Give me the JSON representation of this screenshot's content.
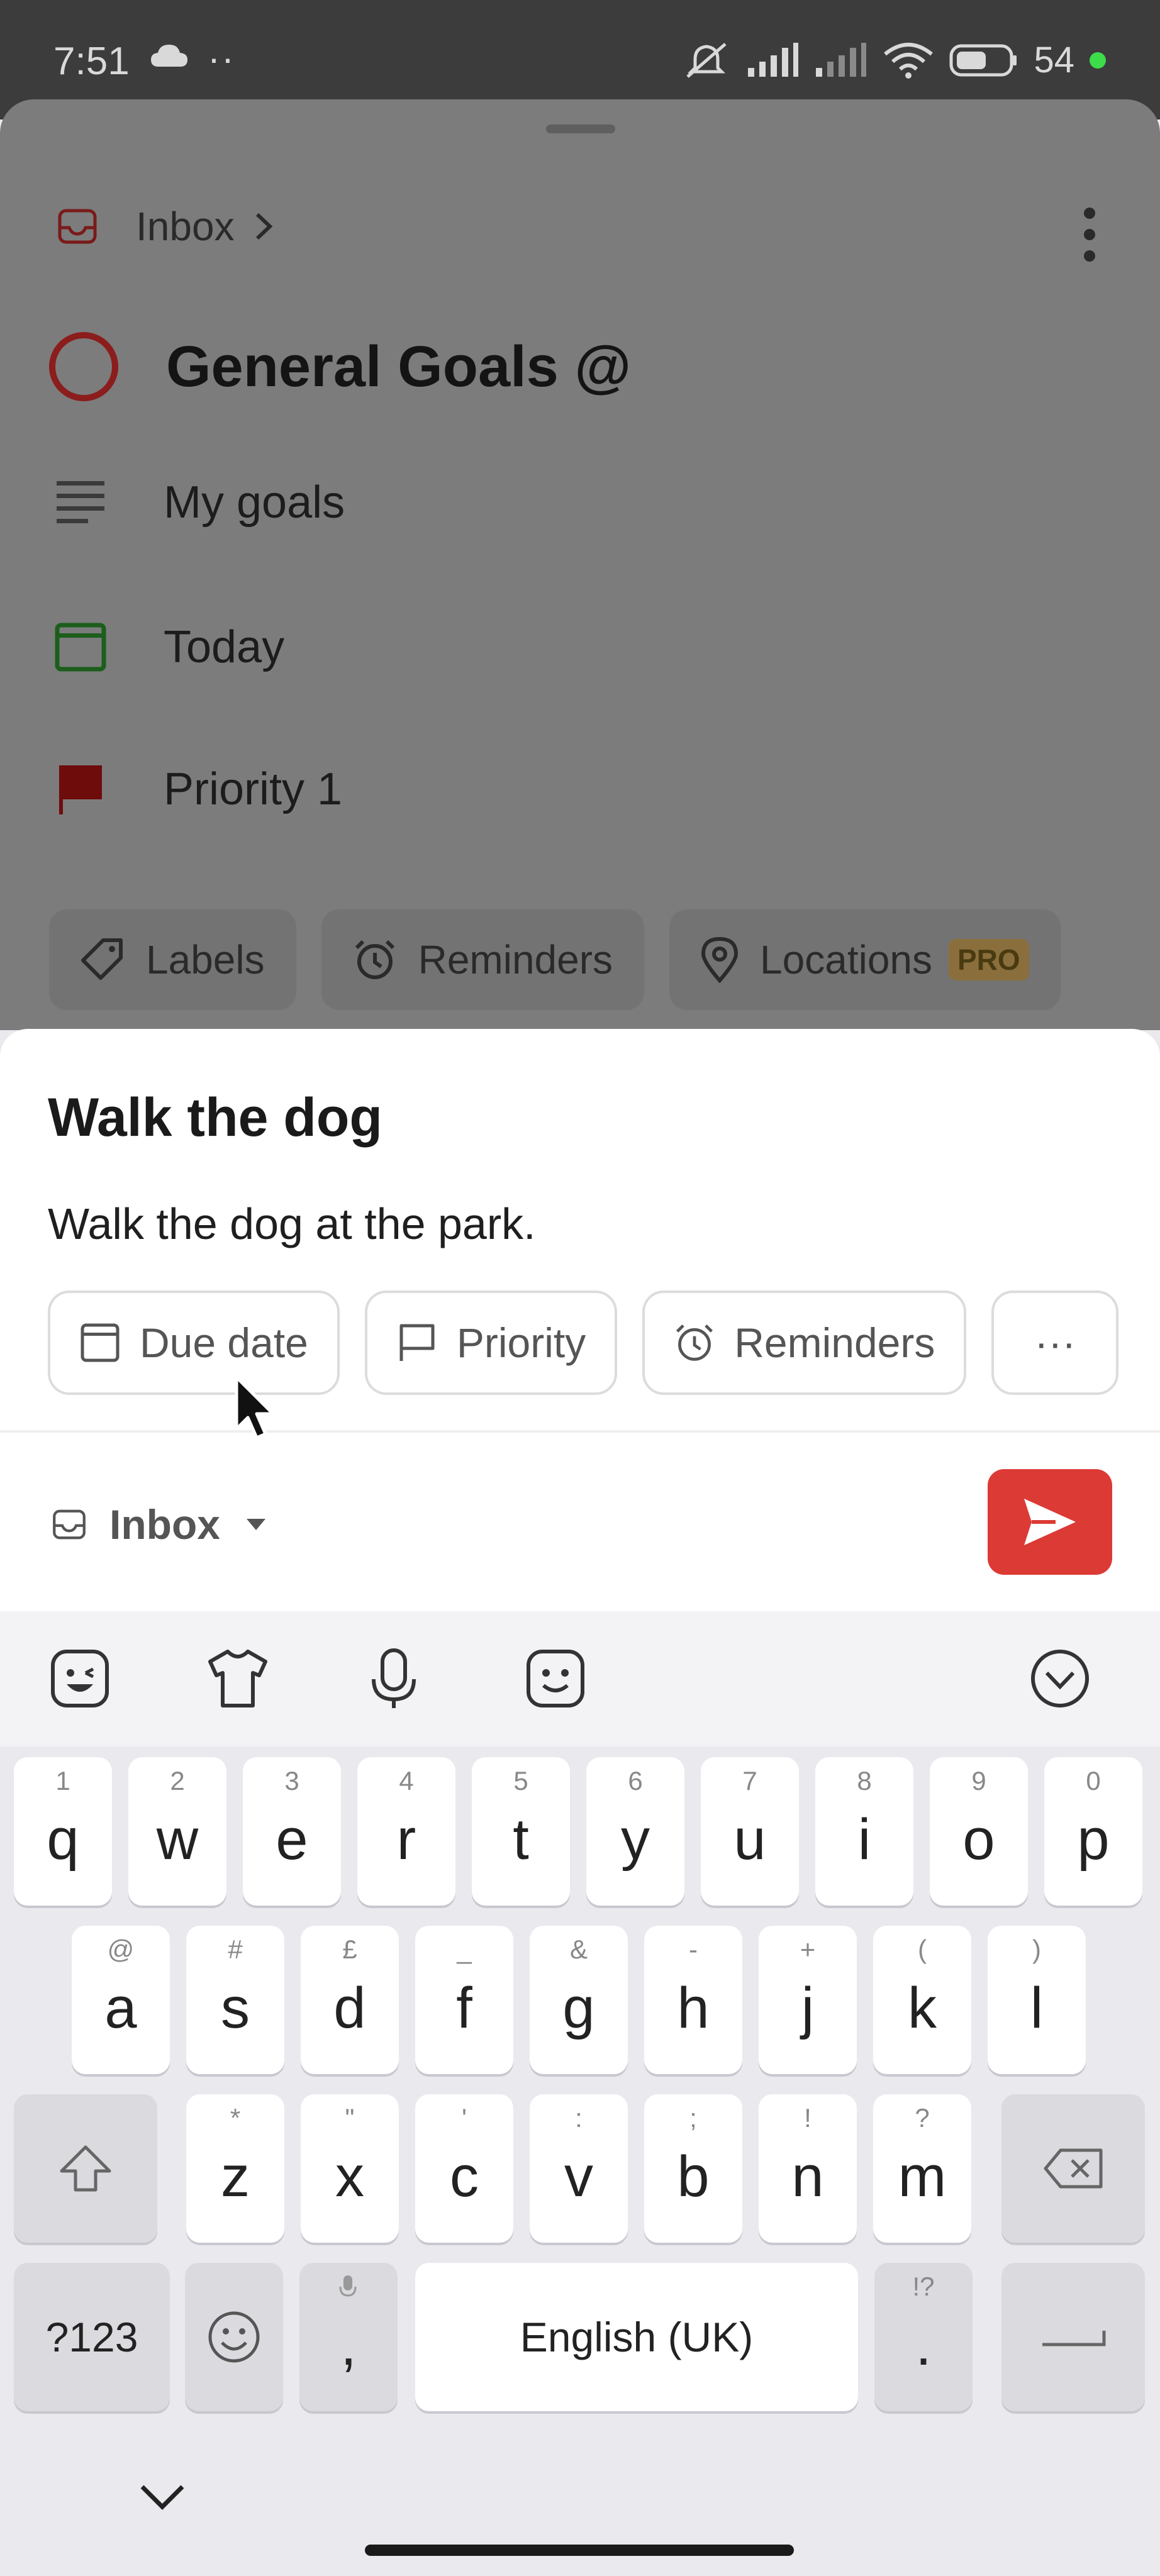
{
  "status_bar": {
    "time": "7:51",
    "extra": "··",
    "battery": "54"
  },
  "detail": {
    "breadcrumb": "Inbox",
    "task_title": "General Goals @",
    "description": "My goals",
    "due": "Today",
    "priority": "Priority 1",
    "chips": {
      "labels": "Labels",
      "reminders": "Reminders",
      "locations": "Locations",
      "pro_badge": "PRO"
    }
  },
  "quick_add": {
    "title": "Walk the dog",
    "description": "Walk the dog at the park.",
    "options": {
      "due_date": "Due date",
      "priority": "Priority",
      "reminders": "Reminders",
      "more": "···"
    },
    "project": "Inbox"
  },
  "keyboard": {
    "row1": [
      {
        "key": "q",
        "hint": "1"
      },
      {
        "key": "w",
        "hint": "2"
      },
      {
        "key": "e",
        "hint": "3"
      },
      {
        "key": "r",
        "hint": "4"
      },
      {
        "key": "t",
        "hint": "5"
      },
      {
        "key": "y",
        "hint": "6"
      },
      {
        "key": "u",
        "hint": "7"
      },
      {
        "key": "i",
        "hint": "8"
      },
      {
        "key": "o",
        "hint": "9"
      },
      {
        "key": "p",
        "hint": "0"
      }
    ],
    "row2": [
      {
        "key": "a",
        "hint": "@"
      },
      {
        "key": "s",
        "hint": "#"
      },
      {
        "key": "d",
        "hint": "£"
      },
      {
        "key": "f",
        "hint": "_"
      },
      {
        "key": "g",
        "hint": "&"
      },
      {
        "key": "h",
        "hint": "-"
      },
      {
        "key": "j",
        "hint": "+"
      },
      {
        "key": "k",
        "hint": "("
      },
      {
        "key": "l",
        "hint": ")"
      }
    ],
    "row3": [
      {
        "key": "z",
        "hint": "*"
      },
      {
        "key": "x",
        "hint": "\""
      },
      {
        "key": "c",
        "hint": "'"
      },
      {
        "key": "v",
        "hint": ":"
      },
      {
        "key": "b",
        "hint": ";"
      },
      {
        "key": "n",
        "hint": "!"
      },
      {
        "key": "m",
        "hint": "?"
      }
    ],
    "symbols": "?123",
    "comma": ",",
    "space": "English (UK)",
    "period": ".",
    "period_hint": "!?"
  }
}
